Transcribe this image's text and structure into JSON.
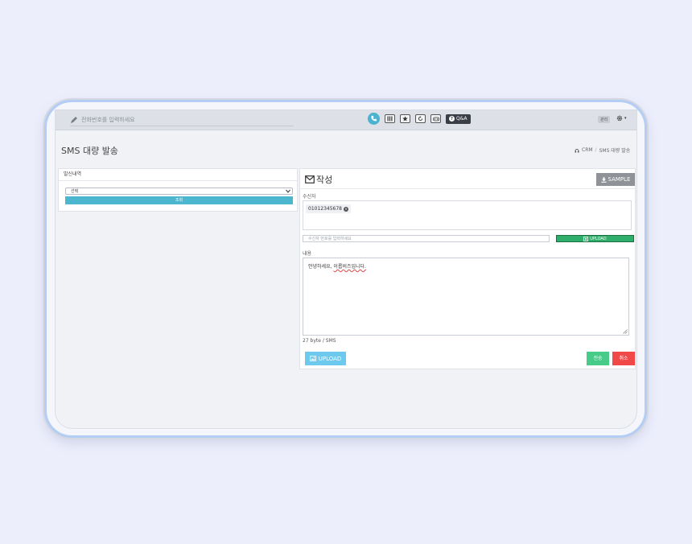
{
  "topbar": {
    "phone_placeholder": "전화번호를 입력하세요",
    "qa_label": "Q&A",
    "user_badge": "관리",
    "gear_caret": "▾"
  },
  "page": {
    "title": "SMS 대량 발송",
    "breadcrumb": [
      "CRM",
      "/",
      "SMS 대량 발송"
    ]
  },
  "history_panel": {
    "title": "발신내역",
    "select_value": "선택",
    "search_label": "조회"
  },
  "compose_panel": {
    "title": "작성",
    "sample_label": "SAMPLE",
    "recipients_label": "수신자",
    "recipient_chips": [
      "01012345678"
    ],
    "number_placeholder": "수신자 번호를 입력하세요",
    "upload_label": "UPLOAD",
    "content_label": "내용",
    "content_text_a": "안녕하세요, ",
    "content_text_b": "이롭비즈입니다.",
    "byte_count": "27 byte / SMS",
    "upload_bottom_label": "UPLOAD",
    "send_label": "전송",
    "cancel_label": "취소"
  },
  "colors": {
    "accent_blue": "#4cb6cf",
    "upload_green": "#2fae6b",
    "send_green": "#46cb88",
    "cancel_red": "#f14848",
    "sample_gray": "#8f9297",
    "upload_light_blue": "#6ec9ee"
  },
  "icons": [
    "pencil-icon",
    "phone-icon",
    "grid-icon",
    "star-icon",
    "refresh-icon",
    "vr-icon",
    "question-icon",
    "gear-icon",
    "headset-icon",
    "envelope-icon",
    "download-icon",
    "upload-icon",
    "image-icon",
    "close-icon",
    "chevron-down-icon"
  ]
}
